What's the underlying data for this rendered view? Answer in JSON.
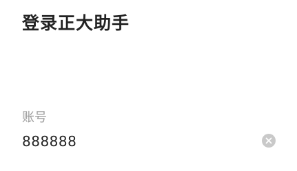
{
  "page": {
    "title": "登录正大助手"
  },
  "account_field": {
    "label": "账号",
    "value": "888888",
    "clear_icon": "close-icon"
  },
  "colors": {
    "title_text": "#222222",
    "label_text": "#9b9b9b",
    "clear_button_bg": "#c9c9c9"
  }
}
